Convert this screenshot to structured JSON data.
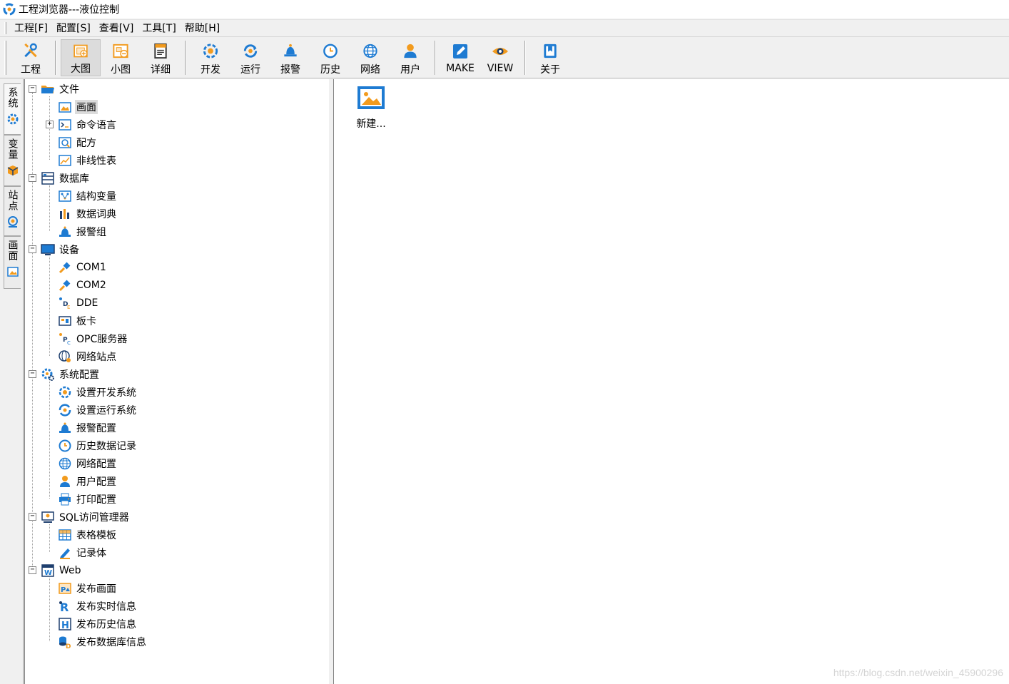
{
  "window": {
    "title": "工程浏览器---液位控制"
  },
  "menu": [
    "工程[F]",
    "配置[S]",
    "查看[V]",
    "工具[T]",
    "帮助[H]"
  ],
  "toolbar": [
    {
      "label": "工程",
      "icon": "tools-icon"
    },
    {
      "label": "大图",
      "icon": "large-icons-icon",
      "active": true
    },
    {
      "label": "小图",
      "icon": "small-icons-icon"
    },
    {
      "label": "详细",
      "icon": "details-icon"
    },
    {
      "label": "开发",
      "icon": "develop-icon"
    },
    {
      "label": "运行",
      "icon": "run-icon"
    },
    {
      "label": "报警",
      "icon": "alarm-bell-icon"
    },
    {
      "label": "历史",
      "icon": "history-clock-icon"
    },
    {
      "label": "网络",
      "icon": "globe-icon"
    },
    {
      "label": "用户",
      "icon": "user-icon"
    },
    {
      "label": "MAKE",
      "icon": "edit-icon"
    },
    {
      "label": "VIEW",
      "icon": "eye-icon"
    },
    {
      "label": "关于",
      "icon": "about-icon"
    }
  ],
  "side_tabs": [
    {
      "label": "系统",
      "icon": "gear-icon"
    },
    {
      "label": "变量",
      "icon": "cube-icon"
    },
    {
      "label": "站点",
      "icon": "station-icon"
    },
    {
      "label": "画面",
      "icon": "picture-icon"
    }
  ],
  "tree": [
    {
      "label": "文件",
      "icon": "folder-icon",
      "children": [
        {
          "label": "画面",
          "icon": "picture-icon",
          "selected": true
        },
        {
          "label": "命令语言",
          "icon": "command-icon",
          "expandable": true
        },
        {
          "label": "配方",
          "icon": "recipe-icon"
        },
        {
          "label": "非线性表",
          "icon": "chart-table-icon"
        }
      ]
    },
    {
      "label": "数据库",
      "icon": "database-icon",
      "children": [
        {
          "label": "结构变量",
          "icon": "struct-variable-icon"
        },
        {
          "label": "数据词典",
          "icon": "data-dictionary-icon"
        },
        {
          "label": "报警组",
          "icon": "alarm-group-icon"
        }
      ]
    },
    {
      "label": "设备",
      "icon": "monitor-icon",
      "children": [
        {
          "label": "COM1",
          "icon": "serial-port-icon"
        },
        {
          "label": "COM2",
          "icon": "serial-port-icon"
        },
        {
          "label": "DDE",
          "icon": "dde-icon"
        },
        {
          "label": "板卡",
          "icon": "board-card-icon"
        },
        {
          "label": "OPC服务器",
          "icon": "opc-server-icon"
        },
        {
          "label": "网络站点",
          "icon": "network-station-icon"
        }
      ]
    },
    {
      "label": "系统配置",
      "icon": "system-config-icon",
      "children": [
        {
          "label": "设置开发系统",
          "icon": "develop-icon"
        },
        {
          "label": "设置运行系统",
          "icon": "run-icon"
        },
        {
          "label": "报警配置",
          "icon": "alarm-bell-icon"
        },
        {
          "label": "历史数据记录",
          "icon": "history-clock-icon"
        },
        {
          "label": "网络配置",
          "icon": "globe-icon"
        },
        {
          "label": "用户配置",
          "icon": "user-icon"
        },
        {
          "label": "打印配置",
          "icon": "printer-icon"
        }
      ]
    },
    {
      "label": "SQL访问管理器",
      "icon": "sql-manager-icon",
      "children": [
        {
          "label": "表格模板",
          "icon": "table-template-icon"
        },
        {
          "label": "记录体",
          "icon": "record-icon"
        }
      ]
    },
    {
      "label": "Web",
      "icon": "web-icon",
      "children": [
        {
          "label": "发布画面",
          "icon": "publish-picture-icon"
        },
        {
          "label": "发布实时信息",
          "icon": "publish-realtime-icon"
        },
        {
          "label": "发布历史信息",
          "icon": "publish-history-icon"
        },
        {
          "label": "发布数据库信息",
          "icon": "publish-database-icon"
        }
      ]
    }
  ],
  "content": {
    "new_item_label": "新建..."
  },
  "watermark": "https://blog.csdn.net/weixin_45900296",
  "colors": {
    "accent_blue": "#1e7bd2",
    "accent_orange": "#f29b1e",
    "selection": "#dcdcdc"
  }
}
